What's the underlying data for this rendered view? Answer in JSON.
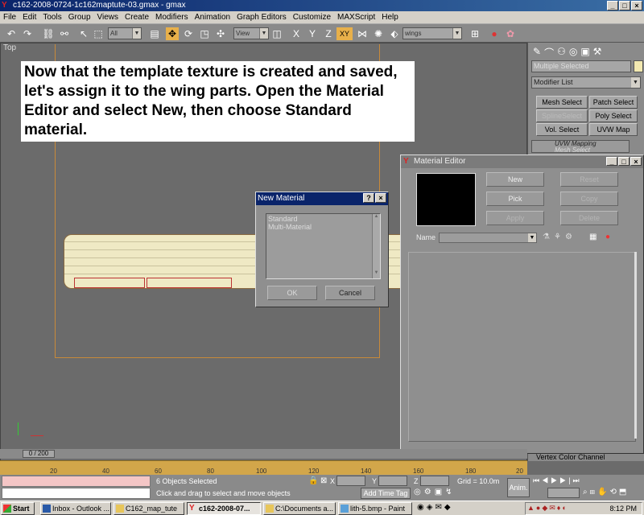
{
  "window": {
    "title": "c162-2008-0724-1c162maptute-03.gmax - gmax"
  },
  "menu": [
    "File",
    "Edit",
    "Tools",
    "Group",
    "Views",
    "Create",
    "Modifiers",
    "Animation",
    "Graph Editors",
    "Customize",
    "MAXScript",
    "Help"
  ],
  "toolbar": {
    "selection_filter": "All",
    "ref_coord": "View",
    "named_selection": "wings"
  },
  "viewport": {
    "label": "Top",
    "tutorial_text": "Now that the template texture is created and saved, let's assign it to the wing parts.  Open the Material Editor and select New, then choose Standard material."
  },
  "command_panel": {
    "selection_name": "Multiple Selected",
    "modifier_list": "Modifier List",
    "buttons": [
      "Mesh Select",
      "Patch Select",
      "SplineSelect",
      "Poly Select",
      "Vol. Select",
      "UVW Map"
    ],
    "stack": [
      "UVW Mapping",
      "Mesh Select"
    ],
    "vertex_color": "Vertex Color Channel"
  },
  "material_editor": {
    "title": "Material Editor",
    "buttons": {
      "new": "New",
      "reset": "Reset",
      "pick": "Pick",
      "copy": "Copy",
      "apply": "Apply",
      "delete": "Delete"
    },
    "name_label": "Name"
  },
  "new_material": {
    "title": "New Material",
    "options": [
      "Standard",
      "Multi-Material"
    ],
    "ok": "OK",
    "cancel": "Cancel"
  },
  "timeline": {
    "frame_readout": "0 / 200",
    "ticks": [
      "20",
      "40",
      "60",
      "80",
      "100",
      "120",
      "140",
      "160",
      "180",
      "20"
    ]
  },
  "status": {
    "selected": "6 Objects Selected",
    "prompt": "Click and drag to select and move objects",
    "x_label": "X",
    "y_label": "Y",
    "z_label": "Z",
    "grid": "Grid = 10.0m",
    "add_time_tag": "Add Time Tag",
    "anim": "Anim."
  },
  "taskbar": {
    "start": "Start",
    "tasks": [
      "Inbox - Outlook ...",
      "C162_map_tute",
      "c162-2008-07...",
      "C:\\Documents a...",
      "lith-5.bmp - Paint"
    ],
    "clock": "8:12 PM"
  },
  "colors": {
    "title_active": "#0a246a",
    "wing_fill": "#efe9c4",
    "ruler": "#d2a64a"
  }
}
